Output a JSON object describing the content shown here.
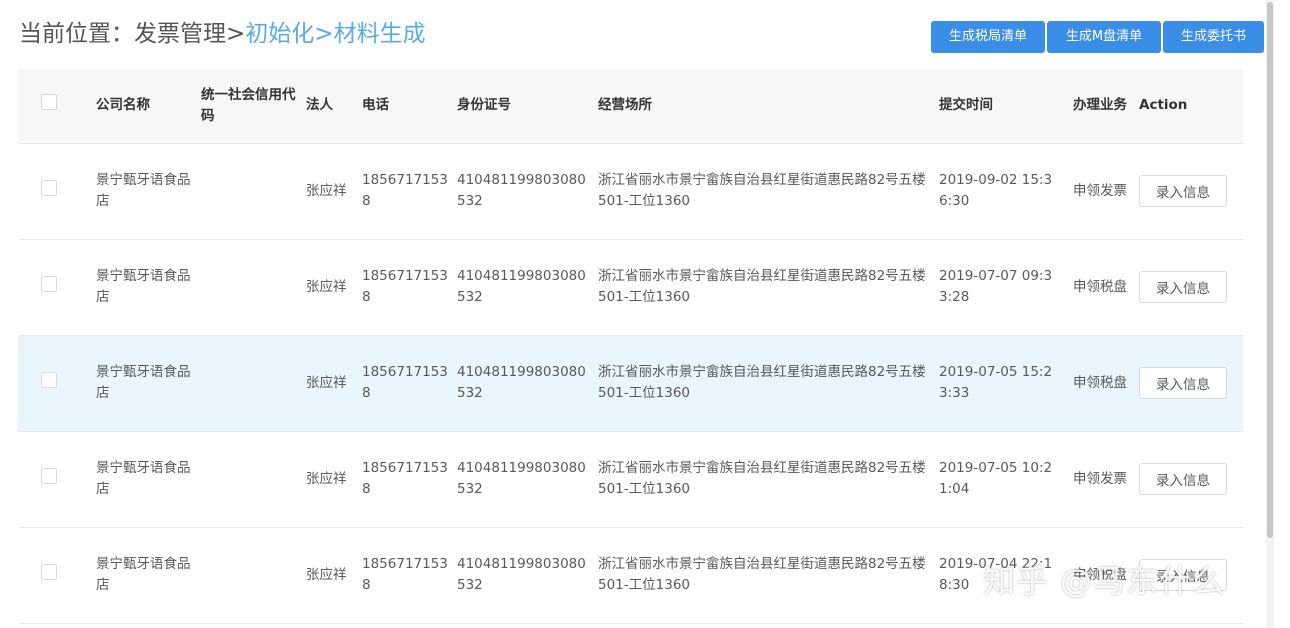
{
  "breadcrumb": {
    "prefix": "当前位置：",
    "parent": "发票管理",
    "sep1": ">",
    "child": "初始化",
    "sep2": ">",
    "current": "材料生成"
  },
  "actions": {
    "tax_list": "生成税局清单",
    "m_list": "生成M盘清单",
    "entrust": "生成委托书"
  },
  "table": {
    "columns": [
      "公司名称",
      "统一社会信用代码",
      "法人",
      "电话",
      "身份证号",
      "经营场所",
      "提交时间",
      "办理业务",
      "Action"
    ],
    "rows": [
      {
        "company": "景宁甄牙语食品店",
        "credit_code": "",
        "legal": "张应祥",
        "phone": "18567171538",
        "id_no": "410481199803080532",
        "address": "浙江省丽水市景宁畲族自治县红星街道惠民路82号五楼501-工位1360",
        "time": "2019-09-02 15:36:30",
        "business": "申领发票",
        "action": "录入信息"
      },
      {
        "company": "景宁甄牙语食品店",
        "credit_code": "",
        "legal": "张应祥",
        "phone": "18567171538",
        "id_no": "410481199803080532",
        "address": "浙江省丽水市景宁畲族自治县红星街道惠民路82号五楼501-工位1360",
        "time": "2019-07-07 09:33:28",
        "business": "申领税盘",
        "action": "录入信息"
      },
      {
        "company": "景宁甄牙语食品店",
        "credit_code": "",
        "legal": "张应祥",
        "phone": "18567171538",
        "id_no": "410481199803080532",
        "address": "浙江省丽水市景宁畲族自治县红星街道惠民路82号五楼501-工位1360",
        "time": "2019-07-05 15:23:33",
        "business": "申领税盘",
        "action": "录入信息"
      },
      {
        "company": "景宁甄牙语食品店",
        "credit_code": "",
        "legal": "张应祥",
        "phone": "18567171538",
        "id_no": "410481199803080532",
        "address": "浙江省丽水市景宁畲族自治县红星街道惠民路82号五楼501-工位1360",
        "time": "2019-07-05 10:21:04",
        "business": "申领发票",
        "action": "录入信息"
      },
      {
        "company": "景宁甄牙语食品店",
        "credit_code": "",
        "legal": "张应祥",
        "phone": "18567171538",
        "id_no": "410481199803080532",
        "address": "浙江省丽水市景宁畲族自治县红星街道惠民路82号五楼501-工位1360",
        "time": "2019-07-04 22:18:30",
        "business": "申领税盘",
        "action": "录入信息"
      }
    ]
  },
  "watermark": "知乎 @马东什么",
  "colors": {
    "accent": "#3b8ee8",
    "link": "#5aaae6",
    "row_highlight": "#e9f6fd",
    "header_bg": "#f7f7f7"
  }
}
